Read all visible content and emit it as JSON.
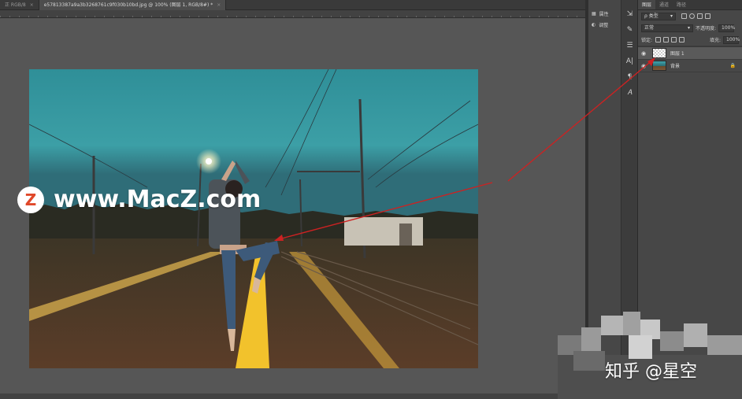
{
  "tabs": [
    {
      "label": "正 RGB/8",
      "active": false
    },
    {
      "label": "e57813387a9a3b3268761c9f030b10bd.jpg @ 100% (图层 1, RGB/8#) *",
      "active": true
    }
  ],
  "properties_panel": {
    "items": [
      {
        "icon": "properties-icon",
        "label": "属性"
      },
      {
        "icon": "adjustments-icon",
        "label": "调整"
      }
    ]
  },
  "tools": [
    "move-tool-icon",
    "brush-tool-icon",
    "settings-sliders-icon",
    "character-icon",
    "paragraph-icon",
    "glyphs-icon"
  ],
  "tool_glyphs": [
    "⇲",
    "✎",
    "☰",
    "A|",
    "¶",
    "𝐴"
  ],
  "layers_panel": {
    "tabs": [
      {
        "label": "图层",
        "active": true
      },
      {
        "label": "通道",
        "active": false
      },
      {
        "label": "路径",
        "active": false
      }
    ],
    "filter_kind": "ρ 类型",
    "blend_mode": "正常",
    "opacity_label": "不透明度:",
    "opacity_value": "100%",
    "lock_label": "锁定:",
    "fill_label": "填充:",
    "fill_value": "100%",
    "layers": [
      {
        "name": "图层 1",
        "selected": true,
        "thumb": "transparent",
        "locked": false
      },
      {
        "name": "背景",
        "selected": false,
        "thumb": "photo",
        "locked": true
      }
    ]
  },
  "watermark": {
    "badge": "Z",
    "text": "www.MacZ.com"
  },
  "zhihu_watermark": "知乎 @星空"
}
